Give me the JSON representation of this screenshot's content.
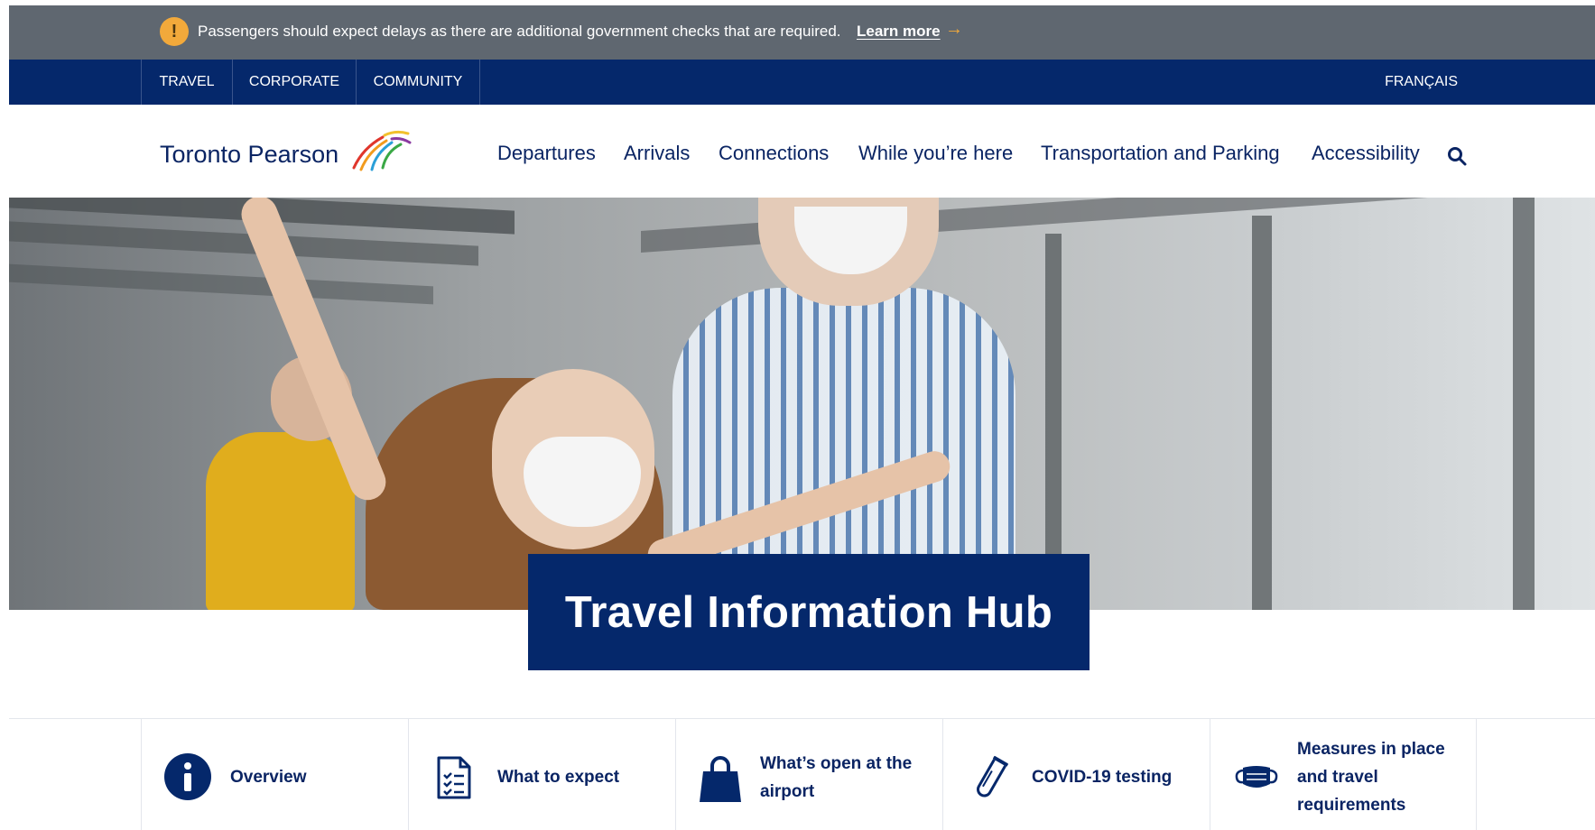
{
  "alert": {
    "icon": "exclamation-icon",
    "text": "Passengers should expect delays as there are additional government checks that are required.",
    "link": "Learn more",
    "arrow": "→",
    "accent": "#f2a93b",
    "background": "#5f6770"
  },
  "utility_nav": {
    "items": [
      "TRAVEL",
      "CORPORATE",
      "COMMUNITY"
    ],
    "language": "FRANÇAIS",
    "background": "#05286b"
  },
  "header": {
    "brand": "Toronto Pearson",
    "logo_icon": "pearson-flight-logo-icon",
    "nav": [
      "Departures",
      "Arrivals",
      "Connections",
      "While you’re here",
      "Transportation and Parking",
      "Accessibility"
    ],
    "search_icon": "search-icon"
  },
  "hero": {
    "title": "Travel Information Hub",
    "title_background": "#05286b"
  },
  "quick_links": [
    {
      "icon": "info-icon",
      "label": "Overview"
    },
    {
      "icon": "checklist-document-icon",
      "label": "What to expect"
    },
    {
      "icon": "shopping-bag-icon",
      "label": "What’s open at the airport"
    },
    {
      "icon": "test-tube-icon",
      "label": "COVID-19 testing"
    },
    {
      "icon": "face-mask-icon",
      "label": "Measures in place and travel requirements"
    }
  ]
}
